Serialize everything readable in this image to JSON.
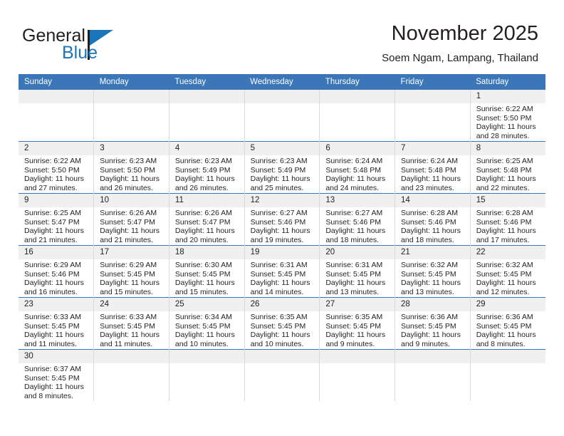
{
  "brand": {
    "name_top": "General",
    "name_bottom": "Blue",
    "flag_icon": "triangle-flag-icon",
    "accent_color": "#1b75bb"
  },
  "header": {
    "title": "November 2025",
    "subtitle": "Soem Ngam, Lampang, Thailand"
  },
  "calendar": {
    "header_color": "#3a76b8",
    "daynum_background": "#f0f0f0",
    "weekdays": [
      "Sunday",
      "Monday",
      "Tuesday",
      "Wednesday",
      "Thursday",
      "Friday",
      "Saturday"
    ],
    "weeks": [
      [
        {
          "day": "",
          "info": ""
        },
        {
          "day": "",
          "info": ""
        },
        {
          "day": "",
          "info": ""
        },
        {
          "day": "",
          "info": ""
        },
        {
          "day": "",
          "info": ""
        },
        {
          "day": "",
          "info": ""
        },
        {
          "day": "1",
          "info": "Sunrise: 6:22 AM\nSunset: 5:50 PM\nDaylight: 11 hours\nand 28 minutes."
        }
      ],
      [
        {
          "day": "2",
          "info": "Sunrise: 6:22 AM\nSunset: 5:50 PM\nDaylight: 11 hours\nand 27 minutes."
        },
        {
          "day": "3",
          "info": "Sunrise: 6:23 AM\nSunset: 5:50 PM\nDaylight: 11 hours\nand 26 minutes."
        },
        {
          "day": "4",
          "info": "Sunrise: 6:23 AM\nSunset: 5:49 PM\nDaylight: 11 hours\nand 26 minutes."
        },
        {
          "day": "5",
          "info": "Sunrise: 6:23 AM\nSunset: 5:49 PM\nDaylight: 11 hours\nand 25 minutes."
        },
        {
          "day": "6",
          "info": "Sunrise: 6:24 AM\nSunset: 5:48 PM\nDaylight: 11 hours\nand 24 minutes."
        },
        {
          "day": "7",
          "info": "Sunrise: 6:24 AM\nSunset: 5:48 PM\nDaylight: 11 hours\nand 23 minutes."
        },
        {
          "day": "8",
          "info": "Sunrise: 6:25 AM\nSunset: 5:48 PM\nDaylight: 11 hours\nand 22 minutes."
        }
      ],
      [
        {
          "day": "9",
          "info": "Sunrise: 6:25 AM\nSunset: 5:47 PM\nDaylight: 11 hours\nand 21 minutes."
        },
        {
          "day": "10",
          "info": "Sunrise: 6:26 AM\nSunset: 5:47 PM\nDaylight: 11 hours\nand 21 minutes."
        },
        {
          "day": "11",
          "info": "Sunrise: 6:26 AM\nSunset: 5:47 PM\nDaylight: 11 hours\nand 20 minutes."
        },
        {
          "day": "12",
          "info": "Sunrise: 6:27 AM\nSunset: 5:46 PM\nDaylight: 11 hours\nand 19 minutes."
        },
        {
          "day": "13",
          "info": "Sunrise: 6:27 AM\nSunset: 5:46 PM\nDaylight: 11 hours\nand 18 minutes."
        },
        {
          "day": "14",
          "info": "Sunrise: 6:28 AM\nSunset: 5:46 PM\nDaylight: 11 hours\nand 18 minutes."
        },
        {
          "day": "15",
          "info": "Sunrise: 6:28 AM\nSunset: 5:46 PM\nDaylight: 11 hours\nand 17 minutes."
        }
      ],
      [
        {
          "day": "16",
          "info": "Sunrise: 6:29 AM\nSunset: 5:46 PM\nDaylight: 11 hours\nand 16 minutes."
        },
        {
          "day": "17",
          "info": "Sunrise: 6:29 AM\nSunset: 5:45 PM\nDaylight: 11 hours\nand 15 minutes."
        },
        {
          "day": "18",
          "info": "Sunrise: 6:30 AM\nSunset: 5:45 PM\nDaylight: 11 hours\nand 15 minutes."
        },
        {
          "day": "19",
          "info": "Sunrise: 6:31 AM\nSunset: 5:45 PM\nDaylight: 11 hours\nand 14 minutes."
        },
        {
          "day": "20",
          "info": "Sunrise: 6:31 AM\nSunset: 5:45 PM\nDaylight: 11 hours\nand 13 minutes."
        },
        {
          "day": "21",
          "info": "Sunrise: 6:32 AM\nSunset: 5:45 PM\nDaylight: 11 hours\nand 13 minutes."
        },
        {
          "day": "22",
          "info": "Sunrise: 6:32 AM\nSunset: 5:45 PM\nDaylight: 11 hours\nand 12 minutes."
        }
      ],
      [
        {
          "day": "23",
          "info": "Sunrise: 6:33 AM\nSunset: 5:45 PM\nDaylight: 11 hours\nand 11 minutes."
        },
        {
          "day": "24",
          "info": "Sunrise: 6:33 AM\nSunset: 5:45 PM\nDaylight: 11 hours\nand 11 minutes."
        },
        {
          "day": "25",
          "info": "Sunrise: 6:34 AM\nSunset: 5:45 PM\nDaylight: 11 hours\nand 10 minutes."
        },
        {
          "day": "26",
          "info": "Sunrise: 6:35 AM\nSunset: 5:45 PM\nDaylight: 11 hours\nand 10 minutes."
        },
        {
          "day": "27",
          "info": "Sunrise: 6:35 AM\nSunset: 5:45 PM\nDaylight: 11 hours\nand 9 minutes."
        },
        {
          "day": "28",
          "info": "Sunrise: 6:36 AM\nSunset: 5:45 PM\nDaylight: 11 hours\nand 9 minutes."
        },
        {
          "day": "29",
          "info": "Sunrise: 6:36 AM\nSunset: 5:45 PM\nDaylight: 11 hours\nand 8 minutes."
        }
      ],
      [
        {
          "day": "30",
          "info": "Sunrise: 6:37 AM\nSunset: 5:45 PM\nDaylight: 11 hours\nand 8 minutes."
        },
        {
          "day": "",
          "info": ""
        },
        {
          "day": "",
          "info": ""
        },
        {
          "day": "",
          "info": ""
        },
        {
          "day": "",
          "info": ""
        },
        {
          "day": "",
          "info": ""
        },
        {
          "day": "",
          "info": ""
        }
      ]
    ]
  }
}
